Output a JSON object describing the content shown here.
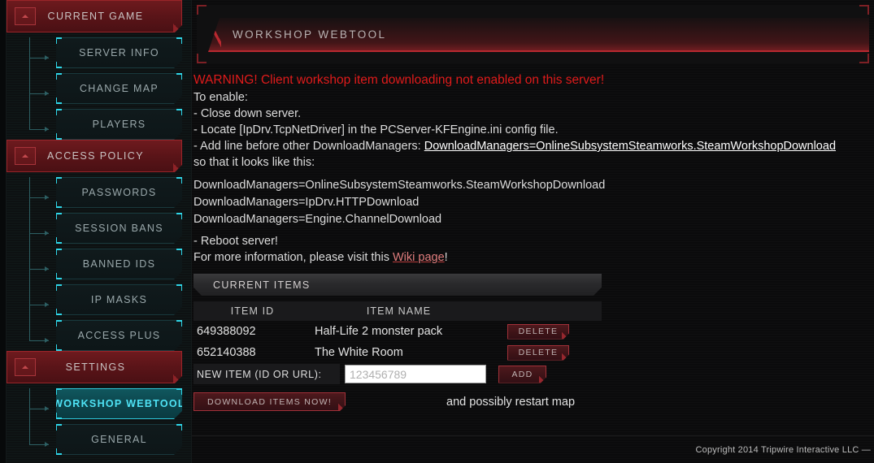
{
  "sidebar": {
    "groups": [
      {
        "label": "CURRENT GAME",
        "toggle_icon": "chevron-up-icon",
        "items": [
          {
            "label": "SERVER INFO",
            "active": false
          },
          {
            "label": "CHANGE MAP",
            "active": false
          },
          {
            "label": "PLAYERS",
            "active": false
          }
        ]
      },
      {
        "label": "ACCESS POLICY",
        "toggle_icon": "chevron-up-icon",
        "items": [
          {
            "label": "PASSWORDS",
            "active": false
          },
          {
            "label": "SESSION BANS",
            "active": false
          },
          {
            "label": "BANNED IDS",
            "active": false
          },
          {
            "label": "IP MASKS",
            "active": false
          },
          {
            "label": "ACCESS PLUS",
            "active": false
          }
        ]
      },
      {
        "label": "SETTINGS",
        "toggle_icon": "chevron-up-icon",
        "items": [
          {
            "label": "WORKSHOP WEBTOOL",
            "active": true
          },
          {
            "label": "GENERAL",
            "active": false
          }
        ]
      }
    ]
  },
  "header": {
    "title": "WORKSHOP WEBTOOL"
  },
  "main": {
    "warning": "WARNING! Client workshop item downloading not enabled on this server!",
    "to_enable_label": "To enable:",
    "steps": [
      "- Close down server.",
      "- Locate [IpDrv.TcpNetDriver] in the PCServer-KFEngine.ini config file."
    ],
    "step_add_prefix": "- Add line before other DownloadManagers: ",
    "step_add_link": "DownloadManagers=OnlineSubsystemSteamworks.SteamWorkshopDownload",
    "looks_like_label": "so that it looks like this:",
    "code_lines": [
      "DownloadManagers=OnlineSubsystemSteamworks.SteamWorkshopDownload",
      "DownloadManagers=IpDrv.HTTPDownload",
      "DownloadManagers=Engine.ChannelDownload"
    ],
    "reboot_label": "- Reboot server!",
    "more_info_prefix": "For more information, please visit this ",
    "more_info_link": "Wiki page",
    "more_info_suffix": "!"
  },
  "items_panel": {
    "section_title": "CURRENT ITEMS",
    "columns": {
      "id": "ITEM ID",
      "name": "ITEM NAME",
      "action": ""
    },
    "rows": [
      {
        "id": "649388092",
        "name": "Half-Life 2 monster pack",
        "action": "DELETE"
      },
      {
        "id": "652140388",
        "name": "The White Room",
        "action": "DELETE"
      }
    ],
    "new_item_label": "NEW ITEM (ID OR URL):",
    "new_item_placeholder": "123456789",
    "new_item_value": "",
    "add_label": "ADD",
    "download_label": "DOWNLOAD ITEMS NOW!",
    "restart_note": "and possibly restart map"
  },
  "footer": {
    "copyright": "Copyright 2014 Tripwire Interactive LLC —"
  }
}
